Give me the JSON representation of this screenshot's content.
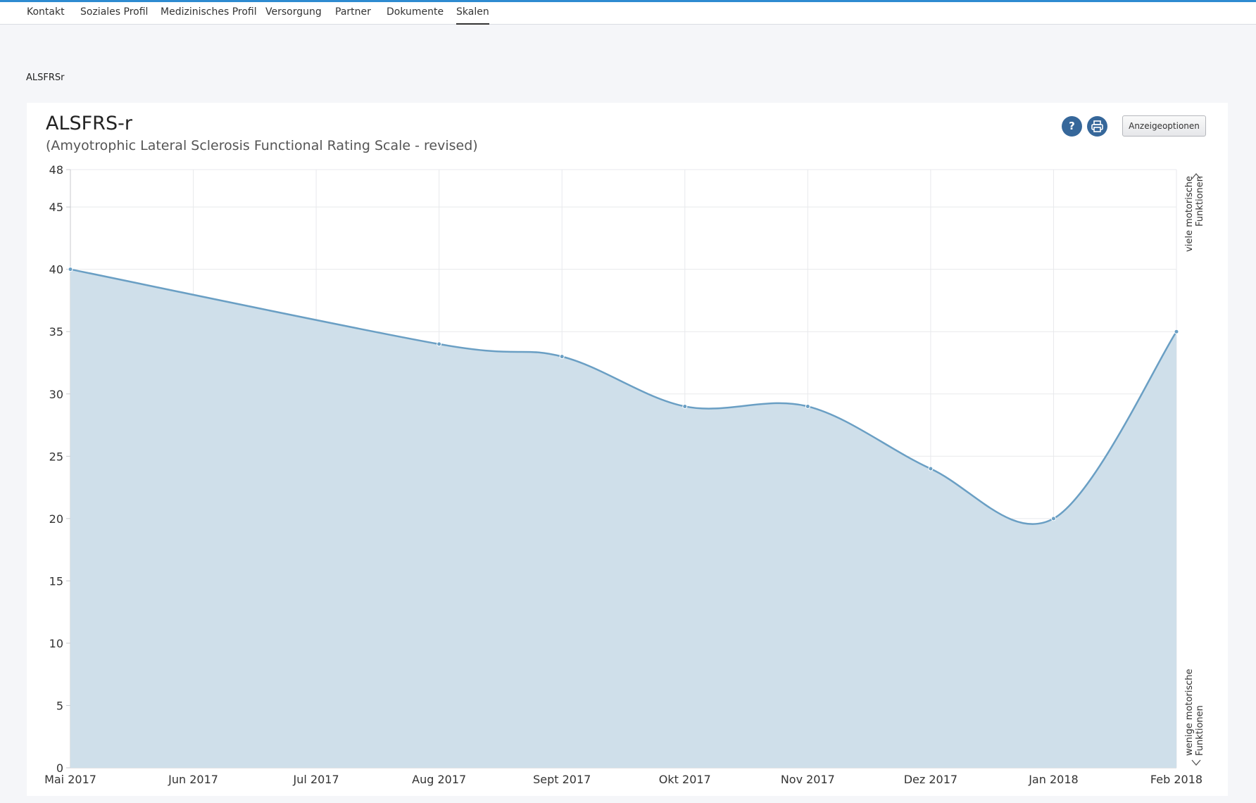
{
  "nav": {
    "items": [
      {
        "label": "Kontakt",
        "active": false
      },
      {
        "label": "Soziales Profil",
        "active": false
      },
      {
        "label": "Medizinisches Profil",
        "active": false
      },
      {
        "label": "Versorgung",
        "active": false
      },
      {
        "label": "Partner",
        "active": false
      },
      {
        "label": "Dokumente",
        "active": false
      },
      {
        "label": "Skalen",
        "active": true
      }
    ]
  },
  "section": {
    "label": "ALSFRSr"
  },
  "card": {
    "title": "ALSFRS-r",
    "subtitle": "(Amyotrophic Lateral Sclerosis Functional Rating Scale - revised)",
    "help_icon": "question-icon",
    "help_glyph": "?",
    "print_icon": "printer-icon",
    "options_label": "Anzeigeoptionen"
  },
  "colors": {
    "accent": "#2e8bd1",
    "button": "#36679a",
    "line": "#6a9fc4",
    "fill": "#cfdfea"
  },
  "chart_data": {
    "type": "area",
    "categories": [
      "Mai 2017",
      "Jun 2017",
      "Jul 2017",
      "Aug 2017",
      "Sept 2017",
      "Okt 2017",
      "Nov 2017",
      "Dez 2017",
      "Jan 2018",
      "Feb 2018"
    ],
    "series": [
      {
        "values": [
          40,
          null,
          null,
          34,
          33,
          29,
          29,
          24,
          20,
          35
        ]
      }
    ],
    "ylim": [
      0,
      48
    ],
    "yticks": [
      0,
      5,
      10,
      15,
      20,
      25,
      30,
      35,
      40,
      45,
      48
    ],
    "grid": true,
    "right_annotation_top": [
      "viele motorische",
      "Funktionen"
    ],
    "right_annotation_bottom": [
      "wenige motorische",
      "Funktionen"
    ]
  }
}
